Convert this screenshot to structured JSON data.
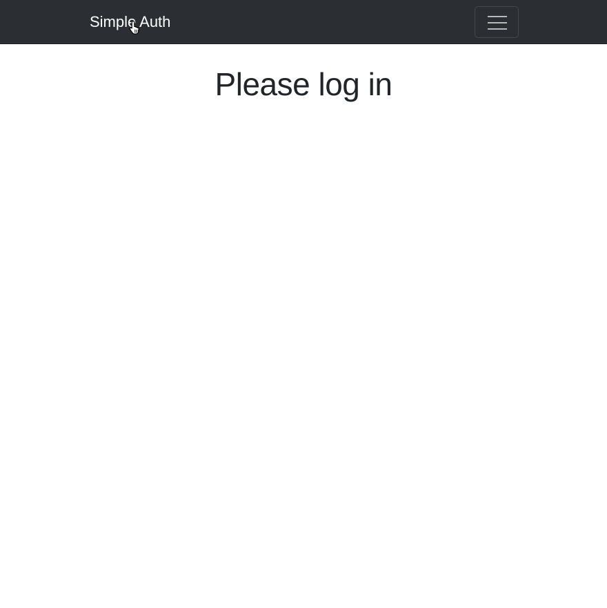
{
  "navbar": {
    "brand": "Simple Auth",
    "toggler_icon": "hamburger-menu-icon",
    "background_color": "#2b2f33"
  },
  "main": {
    "heading": "Please log in"
  },
  "cursor": {
    "icon": "hand-pointer-cursor-icon"
  }
}
